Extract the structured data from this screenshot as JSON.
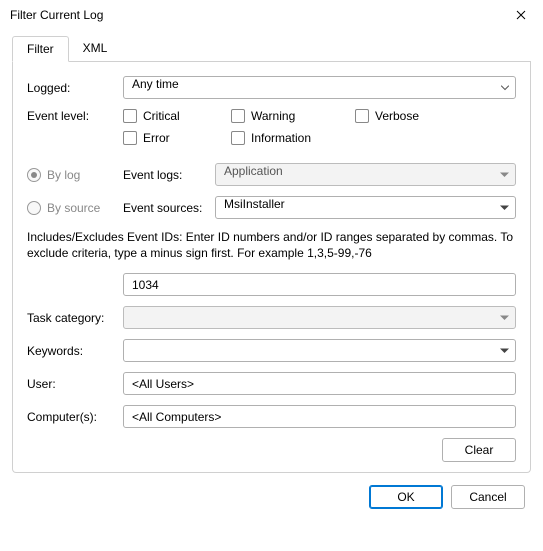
{
  "window": {
    "title": "Filter Current Log"
  },
  "tabs": {
    "filter": "Filter",
    "xml": "XML"
  },
  "labels": {
    "logged": "Logged:",
    "event_level": "Event level:",
    "by_log": "By log",
    "by_source": "By source",
    "event_logs": "Event logs:",
    "event_sources": "Event sources:",
    "task_category": "Task category:",
    "keywords": "Keywords:",
    "user": "User:",
    "computers": "Computer(s):"
  },
  "values": {
    "logged": "Any time",
    "event_logs": "Application",
    "event_sources": "MsiInstaller",
    "event_ids": "1034",
    "task_category": "",
    "keywords": "",
    "user": "<All Users>",
    "computers": "<All Computers>"
  },
  "levels": {
    "critical": "Critical",
    "warning": "Warning",
    "verbose": "Verbose",
    "error": "Error",
    "information": "Information"
  },
  "help_text": "Includes/Excludes Event IDs: Enter ID numbers and/or ID ranges separated by commas. To exclude criteria, type a minus sign first. For example 1,3,5-99,-76",
  "buttons": {
    "clear": "Clear",
    "ok": "OK",
    "cancel": "Cancel"
  }
}
